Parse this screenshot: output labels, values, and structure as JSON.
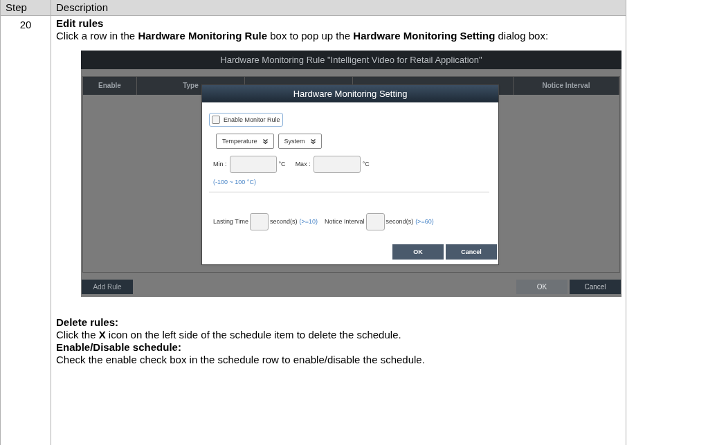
{
  "table": {
    "columns": [
      "Step",
      "Description"
    ],
    "rows": [
      {
        "step": "20",
        "heading": "Edit rules",
        "intro": "Click a row in the **Hardware Monitoring Rule** box to pop up the **Hardware Monitoring Setting** dialog box:",
        "screenshot": {
          "window_title": "Hardware Monitoring Rule \"Intelligent Video for Retail Application\"",
          "columns": [
            "Enable",
            "Type",
            "Notice Interval"
          ],
          "dialog": {
            "title": "Hardware Monitoring Setting",
            "checkbox": {
              "label": "Enable Monitor Rule",
              "checked": false
            },
            "dropdowns": [
              "Temperature",
              "System"
            ],
            "min_label": "Min :",
            "min_unit": "°C",
            "max_label": "Max :",
            "max_unit": "°C",
            "range_hint": "(-100 ~ 100 °C)",
            "lasting_label": "Lasting Time",
            "lasting_unit": "second(s)",
            "lasting_hint": "(>=10)",
            "notice_label": "Notice Interval",
            "notice_unit": "second(s)",
            "notice_hint": "(>=60)",
            "buttons": [
              "OK",
              "Cancel"
            ]
          },
          "add_button": "Add Rule",
          "footer_buttons": [
            {
              "label": "OK",
              "disabled": true
            },
            {
              "label": "Cancel",
              "disabled": false
            }
          ]
        },
        "notes": [
          {
            "kind": "heading",
            "text": "Delete rules:"
          },
          {
            "kind": "body",
            "text": "Click the **X** icon on the left side of the schedule item to delete the schedule."
          },
          {
            "kind": "heading",
            "text": "Enable/Disable schedule:"
          },
          {
            "kind": "body",
            "text": "Check the enable check box in the schedule row to enable/disable the schedule."
          }
        ]
      }
    ]
  }
}
